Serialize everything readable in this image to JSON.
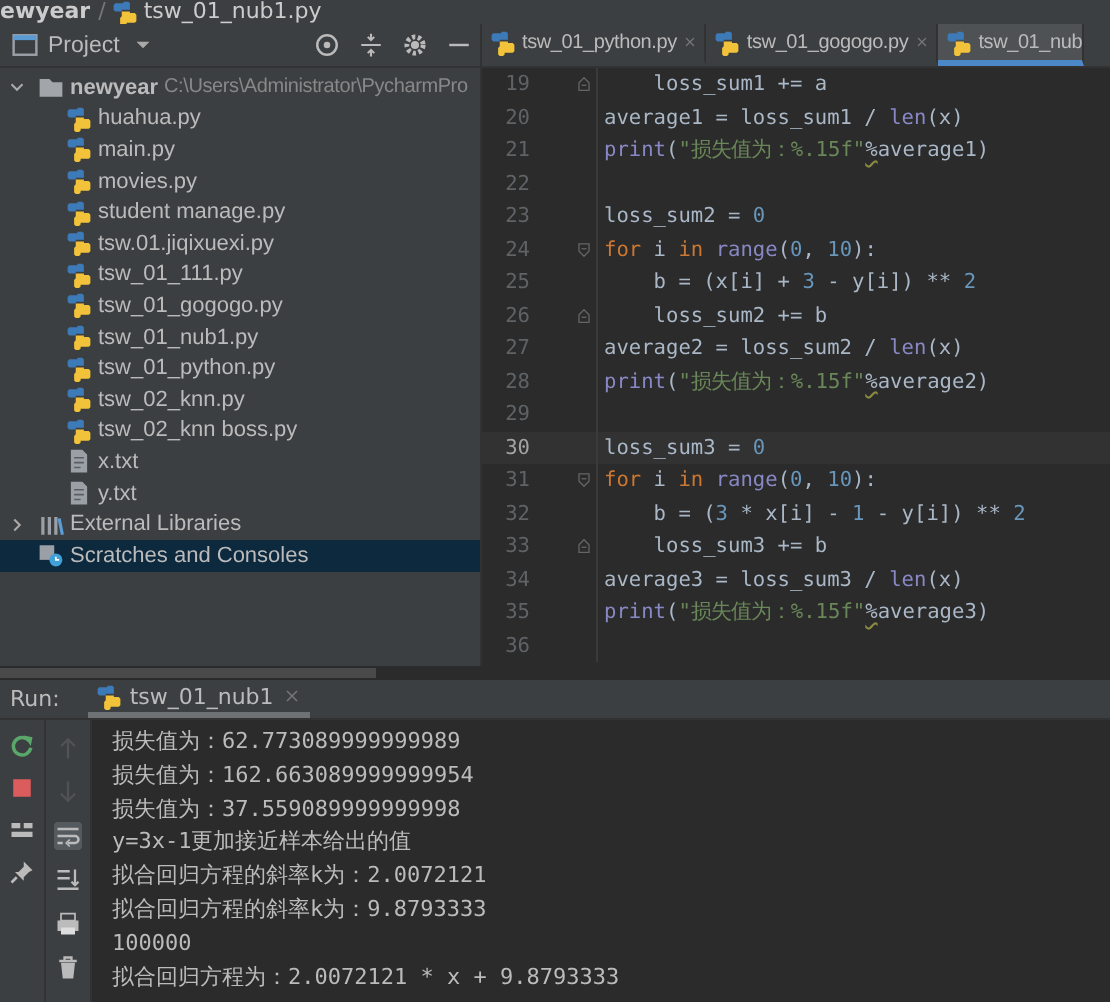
{
  "breadcrumb": {
    "items": [
      {
        "label": "ewyear"
      },
      {
        "label": "tsw_01_nub1.py",
        "kind": "python",
        "separator": "/"
      }
    ]
  },
  "project": {
    "title": "Project",
    "tree": [
      {
        "label": "newyear",
        "path": "C:\\Users\\Administrator\\PycharmPro",
        "kind": "folder",
        "expanded": true,
        "selected": false,
        "children": [
          {
            "label": "huahua.py",
            "kind": "python",
            "selected": false
          },
          {
            "label": "main.py",
            "kind": "python",
            "selected": false
          },
          {
            "label": "movies.py",
            "kind": "python",
            "selected": false
          },
          {
            "label": "student manage.py",
            "kind": "python",
            "selected": false
          },
          {
            "label": "tsw.01.jiqixuexi.py",
            "kind": "python",
            "selected": false
          },
          {
            "label": "tsw_01_111.py",
            "kind": "python",
            "selected": false
          },
          {
            "label": "tsw_01_gogogo.py",
            "kind": "python",
            "selected": false
          },
          {
            "label": "tsw_01_nub1.py",
            "kind": "python",
            "selected": false
          },
          {
            "label": "tsw_01_python.py",
            "kind": "python",
            "selected": false
          },
          {
            "label": "tsw_02_knn.py",
            "kind": "python",
            "selected": false
          },
          {
            "label": "tsw_02_knn boss.py",
            "kind": "python",
            "selected": false
          },
          {
            "label": "x.txt",
            "kind": "text",
            "selected": false
          },
          {
            "label": "y.txt",
            "kind": "text",
            "selected": false
          }
        ]
      },
      {
        "label": "External Libraries",
        "kind": "library",
        "expanded": false,
        "selected": false
      },
      {
        "label": "Scratches and Consoles",
        "kind": "scratches",
        "selected": true
      }
    ]
  },
  "editor": {
    "tabs": [
      {
        "label": "tsw_01_python.py",
        "selected": false,
        "closable": true
      },
      {
        "label": "tsw_01_gogogo.py",
        "selected": false,
        "closable": true
      },
      {
        "label": "tsw_01_nub",
        "selected": true,
        "closable": false
      }
    ],
    "lines": [
      {
        "number": "19",
        "current": false,
        "fold_start": false,
        "fold_end": true,
        "tokens": [
          {
            "kind": "plain",
            "text": "    loss_sum1 += a"
          }
        ]
      },
      {
        "number": "20",
        "current": false,
        "fold_start": false,
        "fold_end": false,
        "tokens": [
          {
            "kind": "plain",
            "text": "average1 = loss_sum1 / "
          },
          {
            "kind": "builtin",
            "text": "len"
          },
          {
            "kind": "plain",
            "text": "(x)"
          }
        ]
      },
      {
        "number": "21",
        "current": false,
        "fold_start": false,
        "fold_end": false,
        "tokens": [
          {
            "kind": "builtin",
            "text": "print"
          },
          {
            "kind": "plain",
            "text": "("
          },
          {
            "kind": "string",
            "text": "\"损失值为：%.15f\""
          },
          {
            "kind": "warning",
            "text": "%"
          },
          {
            "kind": "plain",
            "text": "average1)"
          }
        ]
      },
      {
        "number": "22",
        "current": false,
        "fold_start": false,
        "fold_end": false
      },
      {
        "number": "23",
        "current": false,
        "fold_start": false,
        "fold_end": false,
        "tokens": [
          {
            "kind": "plain",
            "text": "loss_sum2 = "
          },
          {
            "kind": "number",
            "text": "0"
          }
        ]
      },
      {
        "number": "24",
        "current": false,
        "fold_start": true,
        "fold_end": false,
        "tokens": [
          {
            "kind": "keyword",
            "text": "for"
          },
          {
            "kind": "plain",
            "text": " i "
          },
          {
            "kind": "keyword",
            "text": "in "
          },
          {
            "kind": "builtin",
            "text": "range"
          },
          {
            "kind": "plain",
            "text": "("
          },
          {
            "kind": "number",
            "text": "0"
          },
          {
            "kind": "plain",
            "text": ", "
          },
          {
            "kind": "number",
            "text": "10"
          },
          {
            "kind": "plain",
            "text": "):"
          }
        ]
      },
      {
        "number": "25",
        "current": false,
        "fold_start": false,
        "fold_end": false,
        "tokens": [
          {
            "kind": "plain",
            "text": "    b = (x[i] + "
          },
          {
            "kind": "number",
            "text": "3"
          },
          {
            "kind": "plain",
            "text": " - y[i]) ** "
          },
          {
            "kind": "number",
            "text": "2"
          }
        ]
      },
      {
        "number": "26",
        "current": false,
        "fold_start": false,
        "fold_end": true,
        "tokens": [
          {
            "kind": "plain",
            "text": "    loss_sum2 += b"
          }
        ]
      },
      {
        "number": "27",
        "current": false,
        "fold_start": false,
        "fold_end": false,
        "tokens": [
          {
            "kind": "plain",
            "text": "average2 = loss_sum2 / "
          },
          {
            "kind": "builtin",
            "text": "len"
          },
          {
            "kind": "plain",
            "text": "(x)"
          }
        ]
      },
      {
        "number": "28",
        "current": false,
        "fold_start": false,
        "fold_end": false,
        "tokens": [
          {
            "kind": "builtin",
            "text": "print"
          },
          {
            "kind": "plain",
            "text": "("
          },
          {
            "kind": "string",
            "text": "\"损失值为：%.15f\""
          },
          {
            "kind": "warning",
            "text": "%"
          },
          {
            "kind": "plain",
            "text": "average2)"
          }
        ]
      },
      {
        "number": "29",
        "current": false,
        "fold_start": false,
        "fold_end": false
      },
      {
        "number": "30",
        "current": true,
        "fold_start": false,
        "fold_end": false,
        "tokens": [
          {
            "kind": "plain",
            "text": "loss_sum3 = "
          },
          {
            "kind": "number",
            "text": "0"
          }
        ]
      },
      {
        "number": "31",
        "current": false,
        "fold_start": true,
        "fold_end": false,
        "tokens": [
          {
            "kind": "keyword",
            "text": "for"
          },
          {
            "kind": "plain",
            "text": " i "
          },
          {
            "kind": "keyword",
            "text": "in "
          },
          {
            "kind": "builtin",
            "text": "range"
          },
          {
            "kind": "plain",
            "text": "("
          },
          {
            "kind": "number",
            "text": "0"
          },
          {
            "kind": "plain",
            "text": ", "
          },
          {
            "kind": "number",
            "text": "10"
          },
          {
            "kind": "plain",
            "text": "):"
          }
        ]
      },
      {
        "number": "32",
        "current": false,
        "fold_start": false,
        "fold_end": false,
        "tokens": [
          {
            "kind": "plain",
            "text": "    b = ("
          },
          {
            "kind": "number",
            "text": "3"
          },
          {
            "kind": "plain",
            "text": " * x[i] - "
          },
          {
            "kind": "number",
            "text": "1"
          },
          {
            "kind": "plain",
            "text": " - y[i]) ** "
          },
          {
            "kind": "number",
            "text": "2"
          }
        ]
      },
      {
        "number": "33",
        "current": false,
        "fold_start": false,
        "fold_end": true,
        "tokens": [
          {
            "kind": "plain",
            "text": "    loss_sum3 += b"
          }
        ]
      },
      {
        "number": "34",
        "current": false,
        "fold_start": false,
        "fold_end": false,
        "tokens": [
          {
            "kind": "plain",
            "text": "average3 = loss_sum3 / "
          },
          {
            "kind": "builtin",
            "text": "len"
          },
          {
            "kind": "plain",
            "text": "(x)"
          }
        ]
      },
      {
        "number": "35",
        "current": false,
        "fold_start": false,
        "fold_end": false,
        "tokens": [
          {
            "kind": "builtin",
            "text": "print"
          },
          {
            "kind": "plain",
            "text": "("
          },
          {
            "kind": "string",
            "text": "\"损失值为：%.15f\""
          },
          {
            "kind": "warning",
            "text": "%"
          },
          {
            "kind": "plain",
            "text": "average3)"
          }
        ]
      },
      {
        "number": "36",
        "current": false,
        "fold_start": false,
        "fold_end": false
      }
    ]
  },
  "run": {
    "label": "Run:",
    "tab": {
      "label": "tsw_01_nub1",
      "selected": true
    },
    "actions": [
      {
        "kind": "rerun"
      },
      {
        "kind": "stop"
      },
      {
        "kind": "layout"
      },
      {
        "kind": "pin"
      }
    ],
    "tools": [
      {
        "kind": "up",
        "disabled": true,
        "on": false
      },
      {
        "kind": "down",
        "disabled": true,
        "on": false
      },
      {
        "kind": "wrap",
        "disabled": false,
        "on": true
      },
      {
        "kind": "scroll-end",
        "disabled": false,
        "on": false
      },
      {
        "kind": "print",
        "disabled": false,
        "on": false
      },
      {
        "kind": "trash",
        "disabled": false,
        "on": false
      }
    ],
    "output": [
      "损失值为：62.773089999999989",
      "损失值为：162.663089999999954",
      "损失值为：37.559089999999998",
      "y=3x-1更加接近样本给出的值",
      "拟合回归方程的斜率k为：2.0072121",
      "拟合回归方程的斜率k为：9.8793333",
      "100000",
      "拟合回归方程为：2.0072121 * x + 9.8793333"
    ]
  }
}
